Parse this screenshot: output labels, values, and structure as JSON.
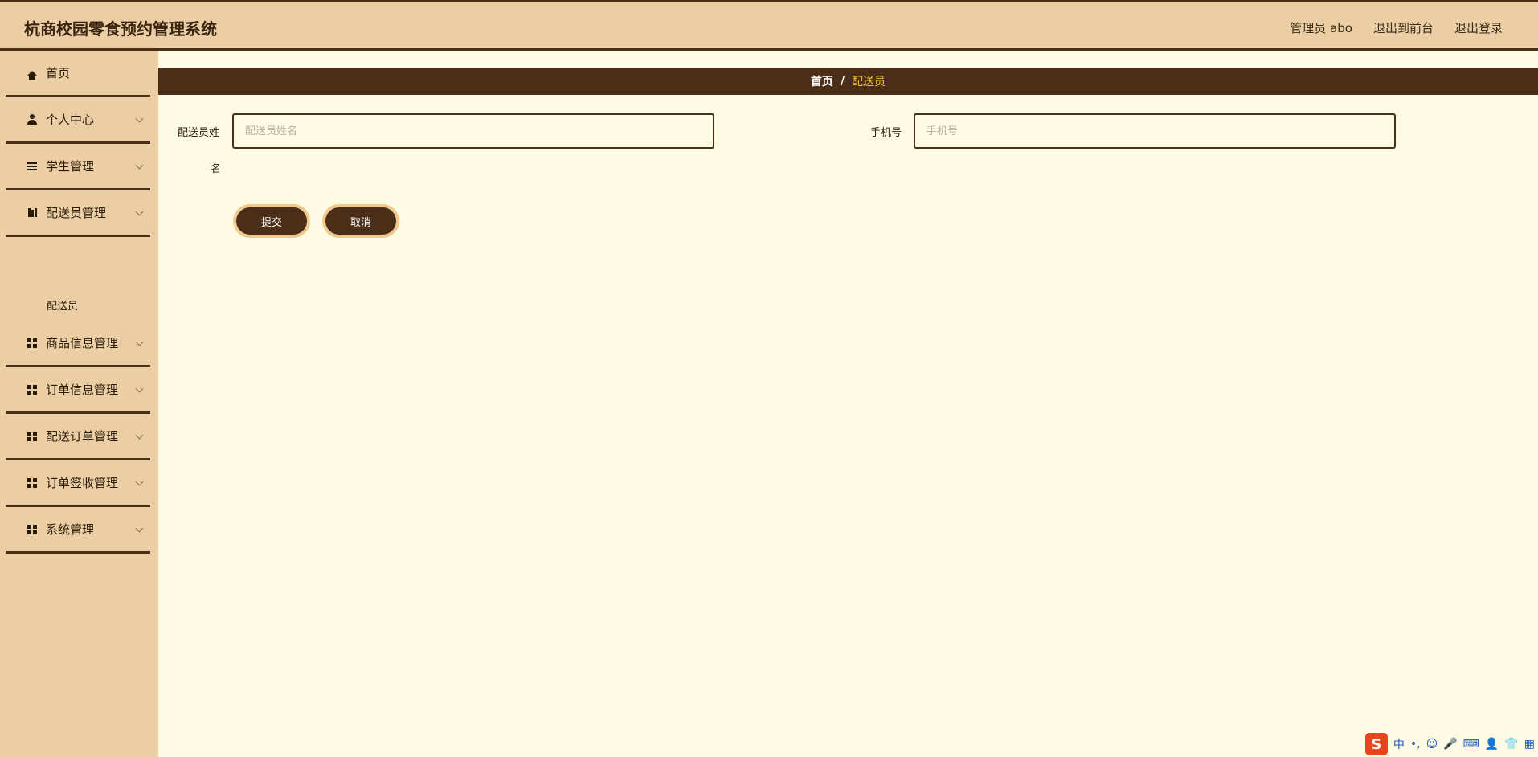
{
  "header": {
    "app_title": "杭商校园零食预约管理系统",
    "user_label": "管理员 abo",
    "back_to_front": "退出到前台",
    "logout": "退出登录"
  },
  "sidebar": {
    "items": [
      {
        "label": "首页",
        "icon": "home-icon"
      },
      {
        "label": "个人中心",
        "icon": "user-icon"
      },
      {
        "label": "学生管理",
        "icon": "list-icon"
      },
      {
        "label": "配送员管理",
        "icon": "book-icon"
      },
      {
        "label": "商品信息管理",
        "icon": "grid-icon"
      },
      {
        "label": "订单信息管理",
        "icon": "grid-icon"
      },
      {
        "label": "配送订单管理",
        "icon": "grid-icon"
      },
      {
        "label": "订单签收管理",
        "icon": "grid-icon"
      },
      {
        "label": "系统管理",
        "icon": "grid-icon"
      }
    ],
    "sub_item": "配送员"
  },
  "breadcrumb": {
    "home": "首页",
    "separator": "/",
    "current": "配送员"
  },
  "form": {
    "name_label_line1": "配送员姓",
    "name_label_line2": "名",
    "name_placeholder": "配送员姓名",
    "phone_label": "手机号",
    "phone_placeholder": "手机号",
    "submit": "提交",
    "cancel": "取消"
  },
  "tray": {
    "ime_label": "中",
    "logo_letter": "S"
  },
  "colors": {
    "header_bg": "#ebcea3",
    "dark_brown": "#4a2e17",
    "content_bg": "#fdfbe4",
    "breadcrumb_current": "#f1c232"
  }
}
